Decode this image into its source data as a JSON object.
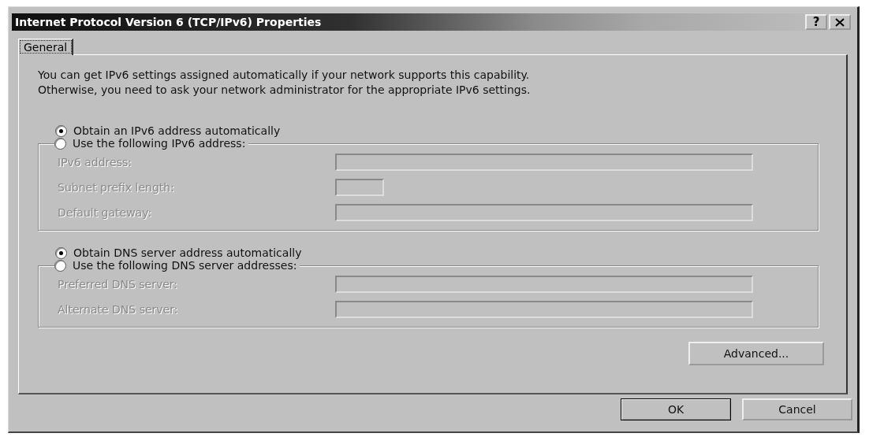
{
  "window": {
    "title": "Internet Protocol Version 6 (TCP/IPv6) Properties",
    "help_button": "?"
  },
  "tabs": [
    {
      "label": "General",
      "selected": true
    }
  ],
  "description": "You can get IPv6 settings assigned automatically if your network supports this capability.\nOtherwise, you need to ask your network administrator for the appropriate IPv6 settings.",
  "sections": [
    {
      "auto_option": {
        "label": "Obtain an IPv6 address automatically",
        "selected": true
      },
      "manual_option": {
        "label": "Use the following IPv6 address:",
        "selected": false
      },
      "fields": [
        {
          "label": "IPv6 address:",
          "kind": "wide",
          "disabled": true
        },
        {
          "label": "Subnet prefix length:",
          "kind": "short",
          "disabled": true
        },
        {
          "label": "Default gateway:",
          "kind": "wide",
          "disabled": true
        }
      ]
    },
    {
      "auto_option": {
        "label": "Obtain DNS server address automatically",
        "selected": true
      },
      "manual_option": {
        "label": "Use the following DNS server addresses:",
        "selected": false
      },
      "fields": [
        {
          "label": "Preferred DNS server:",
          "kind": "wide",
          "disabled": true
        },
        {
          "label": "Alternate DNS server:",
          "kind": "wide",
          "disabled": true
        }
      ]
    }
  ],
  "advanced_button": "Advanced...",
  "buttons": [
    {
      "label": "OK",
      "default": true
    },
    {
      "label": "Cancel",
      "default": false
    }
  ]
}
